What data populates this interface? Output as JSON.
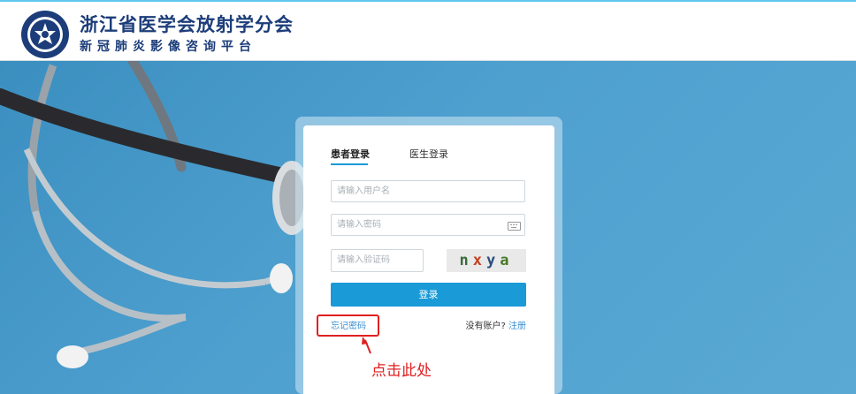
{
  "header": {
    "title": "浙江省医学会放射学分会",
    "subtitle": "新冠肺炎影像咨询平台"
  },
  "login": {
    "tabs": [
      {
        "label": "患者登录",
        "active": true
      },
      {
        "label": "医生登录",
        "active": false
      }
    ],
    "username_placeholder": "请输入用户名",
    "password_placeholder": "请输入密码",
    "captcha_placeholder": "请输入验证码",
    "captcha_text": [
      "n",
      "x",
      "y",
      "a"
    ],
    "login_button": "登录",
    "forgot_password": "忘记密码",
    "no_account": "没有账户?",
    "register": "注册"
  },
  "annotation": {
    "text": "点击此处",
    "color": "#e02020"
  },
  "colors": {
    "accent": "#1a9ad6",
    "brand": "#1c3d7a",
    "link": "#3a8fd0"
  }
}
